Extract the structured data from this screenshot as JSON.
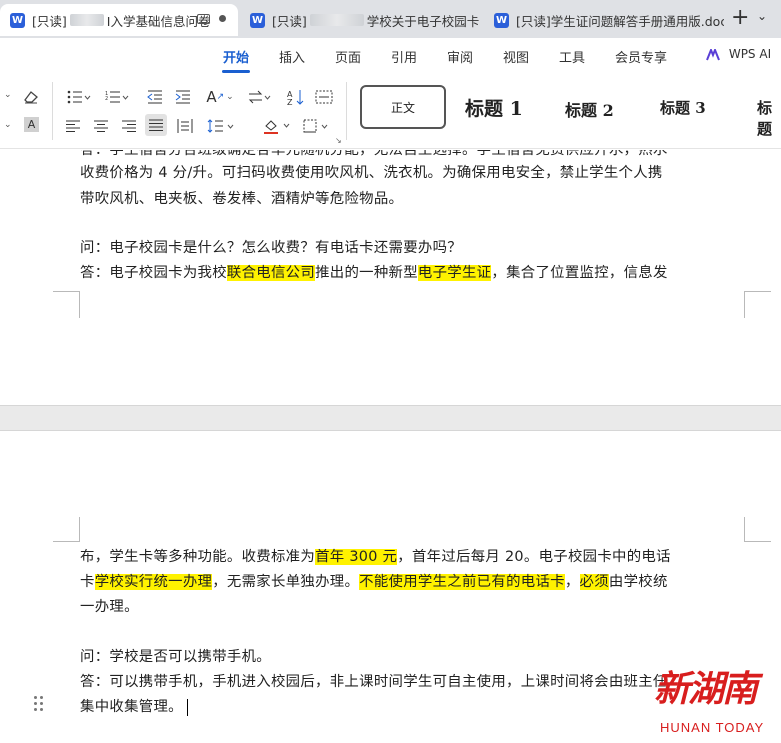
{
  "tabs": [
    {
      "prefix": "[只读]",
      "visible_text": "I入学基础信息问卷"
    },
    {
      "prefix": "[只读]",
      "visible_text": "学校关于电子校园卡"
    },
    {
      "prefix": "[只读]",
      "visible_text": "学生证问题解答手册通用版.doc"
    }
  ],
  "menu": {
    "items": [
      "开始",
      "插入",
      "页面",
      "引用",
      "审阅",
      "视图",
      "工具",
      "会员专享"
    ],
    "active": "开始",
    "wps_ai": "WPS AI"
  },
  "ribbon": {
    "style_normal": "正文",
    "styles": [
      "标题 1",
      "标题 2",
      "标题 3",
      "标题"
    ],
    "font_color_label": "A"
  },
  "page1": {
    "line0": "答：学生宿舍分合班级确定各单元随机分配，无法自主选择。学生宿舍免费供应开水，热水",
    "line1": "收费价格为 4 分/升。可扫码收费使用吹风机、洗衣机。为确保用电安全，禁止学生个人携",
    "line2": "带吹风机、电夹板、卷发棒、酒精炉等危险物品。",
    "q": "问：电子校园卡是什么？怎么收费？有电话卡还需要办吗？",
    "a_part1": "答：电子校园卡为我校",
    "a_hl1": "联合电信公司",
    "a_part2": "推出的一种新型",
    "a_hl2": "电子学生证",
    "a_part3": "，集合了位置监控，信息发"
  },
  "page2": {
    "l1_a": "布，学生卡等多种功能。收费标准为",
    "l1_hl": "首年 300 元",
    "l1_b": "，首年过后每月 20。电子校园卡中的电话",
    "l2_a": "卡",
    "l2_hl1": "学校实行统一办理",
    "l2_b": "，无需家长单独办理。",
    "l2_hl2": "不能使用学生之前已有的电话卡",
    "l2_c": "，",
    "l2_hl3": "必须",
    "l2_d": "由学校统",
    "l3": "一办理。",
    "q": "问：学校是否可以携带手机。",
    "a1": "答：可以携带手机，手机进入校园后，非上课时间学生可自主使用，上课时间将会由班主任",
    "a2": "集中收集管理。"
  },
  "watermark": {
    "cn": "新湖南",
    "en": "HUNAN TODAY"
  },
  "colors": {
    "accent": "#1a5fd0",
    "highlight": "#fff200",
    "word_icon": "#2b5fd9",
    "watermark": "#d81e1e"
  }
}
